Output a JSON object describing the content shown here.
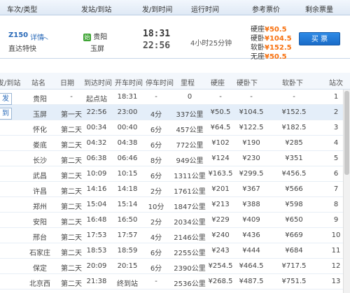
{
  "header": {
    "col_train": "车次/类型",
    "col_stations": "发站/到站",
    "col_times": "发/到时间",
    "col_duration": "运行时间",
    "col_fare": "参考票价",
    "col_remaining": "剩余票量"
  },
  "train": {
    "number": "Z150",
    "details_link": "详情",
    "type": "直达特快",
    "from_badge": "始",
    "from": "贵阳",
    "to": "玉屏",
    "depart": "18:31",
    "arrive": "22:56",
    "duration": "4小时25分钟",
    "fares": [
      {
        "label": "硬座",
        "price": "¥50.5"
      },
      {
        "label": "硬卧",
        "price": "¥104.5"
      },
      {
        "label": "软卧",
        "price": "¥152.5"
      },
      {
        "label": "无座",
        "price": "¥50.5"
      }
    ],
    "buy_label": "买 票",
    "side_depart": "发",
    "side_arrive": "到"
  },
  "stops_table": {
    "columns": [
      "发/到站",
      "站名",
      "日期",
      "到达时间",
      "开车时间",
      "停车时间",
      "里程",
      "硬座",
      "硬卧下",
      "软卧下",
      "站次"
    ],
    "rows": [
      {
        "station": "贵阳",
        "day": "-",
        "arrive": "起点站",
        "depart": "18:31",
        "stop": "-",
        "km": "0",
        "seat": "-",
        "hard": "-",
        "soft": "-",
        "no": "1"
      },
      {
        "station": "玉屏",
        "day": "第一天",
        "arrive": "22:56",
        "depart": "23:00",
        "stop": "4分",
        "km": "337公里",
        "seat": "¥50.5",
        "hard": "¥104.5",
        "soft": "¥152.5",
        "no": "2"
      },
      {
        "station": "怀化",
        "day": "第二天",
        "arrive": "00:34",
        "depart": "00:40",
        "stop": "6分",
        "km": "457公里",
        "seat": "¥64.5",
        "hard": "¥122.5",
        "soft": "¥182.5",
        "no": "3"
      },
      {
        "station": "娄底",
        "day": "第二天",
        "arrive": "04:32",
        "depart": "04:38",
        "stop": "6分",
        "km": "772公里",
        "seat": "¥102",
        "hard": "¥190",
        "soft": "¥285",
        "no": "4"
      },
      {
        "station": "长沙",
        "day": "第二天",
        "arrive": "06:38",
        "depart": "06:46",
        "stop": "8分",
        "km": "949公里",
        "seat": "¥124",
        "hard": "¥230",
        "soft": "¥351",
        "no": "5"
      },
      {
        "station": "武昌",
        "day": "第二天",
        "arrive": "10:09",
        "depart": "10:15",
        "stop": "6分",
        "km": "1311公里",
        "seat": "¥163.5",
        "hard": "¥299.5",
        "soft": "¥456.5",
        "no": "6"
      },
      {
        "station": "许昌",
        "day": "第二天",
        "arrive": "14:16",
        "depart": "14:18",
        "stop": "2分",
        "km": "1761公里",
        "seat": "¥201",
        "hard": "¥367",
        "soft": "¥566",
        "no": "7"
      },
      {
        "station": "郑州",
        "day": "第二天",
        "arrive": "15:04",
        "depart": "15:14",
        "stop": "10分",
        "km": "1847公里",
        "seat": "¥213",
        "hard": "¥388",
        "soft": "¥598",
        "no": "8"
      },
      {
        "station": "安阳",
        "day": "第二天",
        "arrive": "16:48",
        "depart": "16:50",
        "stop": "2分",
        "km": "2034公里",
        "seat": "¥229",
        "hard": "¥409",
        "soft": "¥650",
        "no": "9"
      },
      {
        "station": "邢台",
        "day": "第二天",
        "arrive": "17:53",
        "depart": "17:57",
        "stop": "4分",
        "km": "2146公里",
        "seat": "¥240",
        "hard": "¥436",
        "soft": "¥669",
        "no": "10"
      },
      {
        "station": "石家庄",
        "day": "第二天",
        "arrive": "18:53",
        "depart": "18:59",
        "stop": "6分",
        "km": "2255公里",
        "seat": "¥243",
        "hard": "¥444",
        "soft": "¥684",
        "no": "11"
      },
      {
        "station": "保定",
        "day": "第二天",
        "arrive": "20:09",
        "depart": "20:15",
        "stop": "6分",
        "km": "2390公里",
        "seat": "¥254.5",
        "hard": "¥464.5",
        "soft": "¥717.5",
        "no": "12"
      },
      {
        "station": "北京西",
        "day": "第二天",
        "arrive": "21:38",
        "depart": "终到站",
        "stop": "-",
        "km": "2536公里",
        "seat": "¥268.5",
        "hard": "¥487.5",
        "soft": "¥751.5",
        "no": "13"
      }
    ]
  },
  "colors": {
    "accent": "#2a6ab8",
    "price": "#f7700e",
    "highlight_row": "#e4eef9"
  }
}
